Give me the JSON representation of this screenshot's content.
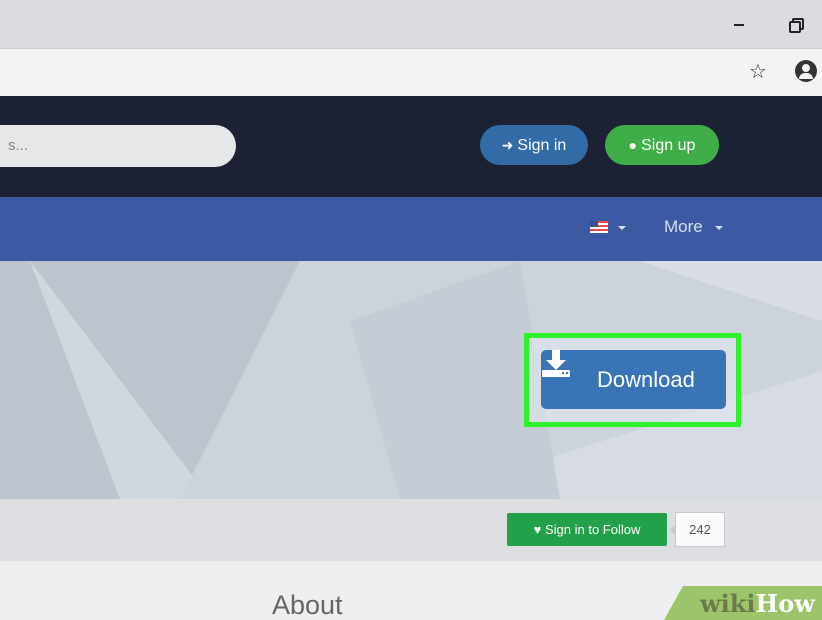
{
  "browser": {
    "icons": [
      "minimize-icon",
      "restore-icon",
      "star-icon",
      "account-icon"
    ]
  },
  "header": {
    "search_placeholder": "s...",
    "signin_label": "Sign in",
    "signup_label": "Sign up",
    "colors": {
      "header_bg": "#1d2134",
      "signin": "#326ba6",
      "signup": "#3fae49"
    }
  },
  "nav": {
    "more_label": "More",
    "colors": {
      "nav_bg": "#3c5aa3"
    }
  },
  "hero": {
    "download_label": "Download",
    "colors": {
      "download": "#3974b7",
      "highlight": "#2ef22e"
    }
  },
  "follow": {
    "button_label": "Sign in to Follow",
    "count": "242"
  },
  "about": {
    "title": "About"
  },
  "watermark": {
    "wiki": "wiki",
    "how": "How"
  }
}
